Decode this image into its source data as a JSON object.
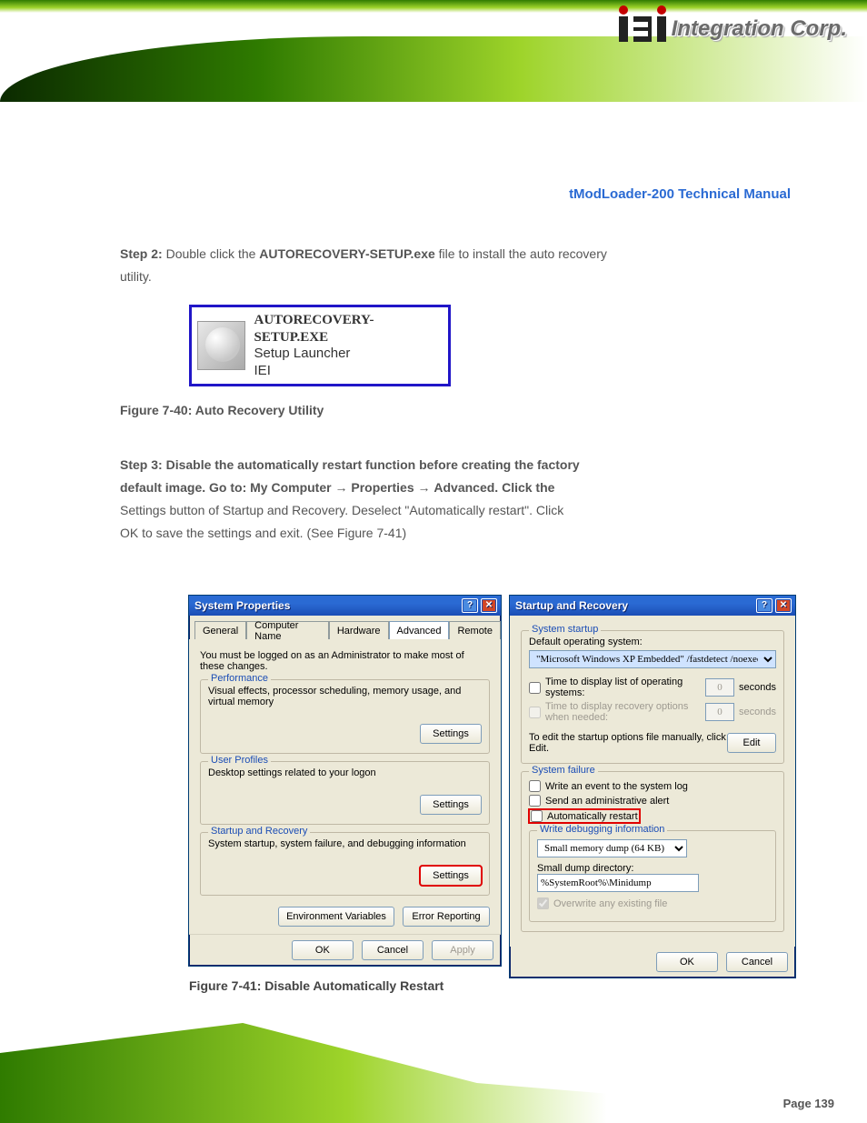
{
  "brand": {
    "company": "Integration Corp."
  },
  "colors": {
    "accent_green": "#2f7b00",
    "xp_blue": "#1b4db5",
    "highlight_red": "#e00000",
    "frame_blue": "#2116c8"
  },
  "doc": {
    "title_line": "tModLoader-200 Technical Manual",
    "step1a": "Double click the ",
    "step1b": "AUTORECOVERY-SETUP.exe",
    "step1c": " file to install the auto recovery",
    "step1d": "utility.",
    "autorecovery": {
      "line1": "AUTORECOVERY-SETUP.EXE",
      "line2": "Setup Launcher",
      "line3": "IEI"
    },
    "fig40": "Figure 7-40: Auto Recovery Utility",
    "step2a": "Step 3: ",
    "step2b": "Disable the automatically restart function before creating the factory",
    "step2c": "default image. Go to: My Computer ",
    "step2d": " Properties ",
    "step2e": " Advanced. Click the",
    "step2f": "Settings button of Startup and Recovery. Deselect \"Automatically restart\". Click",
    "step2g": "OK to save the settings and exit. (See Figure 7-41)",
    "fig41": "Figure 7-41: Disable Automatically Restart",
    "prefix_step": "Step 2: "
  },
  "page": {
    "number": "Page 139"
  },
  "sysprops": {
    "title": "System Properties",
    "tabs": [
      "General",
      "Computer Name",
      "Hardware",
      "Advanced",
      "Remote"
    ],
    "admin_note": "You must be logged on as an Administrator to make most of these changes.",
    "perf": {
      "legend": "Performance",
      "desc": "Visual effects, processor scheduling, memory usage, and virtual memory",
      "btn": "Settings"
    },
    "prof": {
      "legend": "User Profiles",
      "desc": "Desktop settings related to your logon",
      "btn": "Settings"
    },
    "start": {
      "legend": "Startup and Recovery",
      "desc": "System startup, system failure, and debugging information",
      "btn": "Settings"
    },
    "env_btn": "Environment Variables",
    "err_btn": "Error Reporting",
    "ok": "OK",
    "cancel": "Cancel",
    "apply": "Apply"
  },
  "startup": {
    "title": "Startup and Recovery",
    "sys_start": {
      "legend": "System startup",
      "defos_lbl": "Default operating system:",
      "defos_val": "\"Microsoft Windows XP Embedded\" /fastdetect /noexecute=Alwa",
      "show_list": "Time to display list of operating systems:",
      "show_recov": "Time to display recovery options when needed:",
      "seconds": "seconds",
      "edit_note": "To edit the startup options file manually, click Edit.",
      "edit": "Edit",
      "val30": "0",
      "val0": "0"
    },
    "sys_fail": {
      "legend": "System failure",
      "evt": "Write an event to the system log",
      "admin": "Send an administrative alert",
      "autorst": "Automatically restart",
      "dbg_legend": "Write debugging information",
      "dump_sel": "Small memory dump (64 KB)",
      "dumpdir_lbl": "Small dump directory:",
      "dumpdir_val": "%SystemRoot%\\Minidump",
      "overwrite": "Overwrite any existing file"
    },
    "ok": "OK",
    "cancel": "Cancel"
  }
}
